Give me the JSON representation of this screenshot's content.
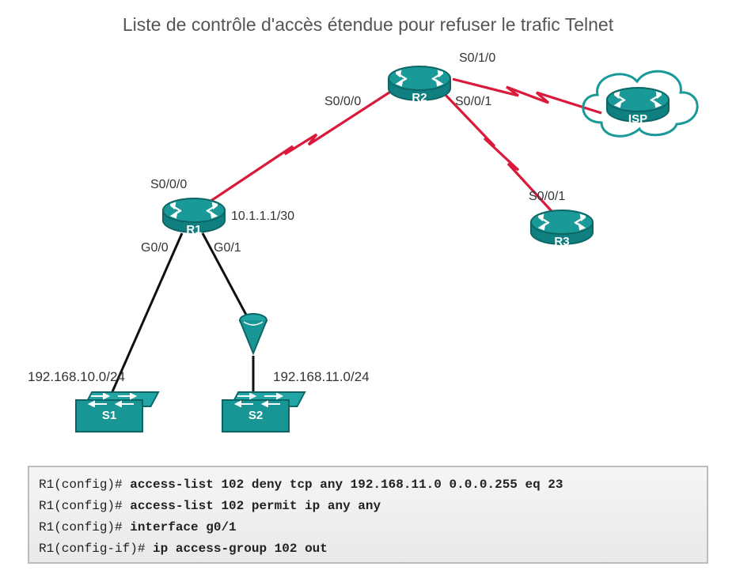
{
  "title": "Liste de contrôle d'accès étendue pour refuser le trafic Telnet",
  "devices": {
    "r1": "R1",
    "r2": "R2",
    "r3": "R3",
    "isp": "ISP",
    "s1": "S1",
    "s2": "S2"
  },
  "interfaces": {
    "r1_s000": "S0/0/0",
    "r1_g00": "G0/0",
    "r1_g01": "G0/1",
    "r1_addr": "10.1.1.1/30",
    "r2_s000": "S0/0/0",
    "r2_s001": "S0/0/1",
    "r2_s010": "S0/1/0",
    "r3_s001": "S0/0/1"
  },
  "networks": {
    "left": "192.168.10.0/24",
    "right": "192.168.11.0/24"
  },
  "cli": {
    "line1_prompt": "R1(config)# ",
    "line1_cmd": "access-list 102 deny tcp any 192.168.11.0 0.0.0.255 eq 23",
    "line2_prompt": "R1(config)# ",
    "line2_cmd": "access-list 102 permit ip any any",
    "line3_prompt": "R1(config)# ",
    "line3_cmd": "interface g0/1",
    "line4_prompt": "R1(config-if)# ",
    "line4_cmd": "ip access-group 102 out"
  }
}
